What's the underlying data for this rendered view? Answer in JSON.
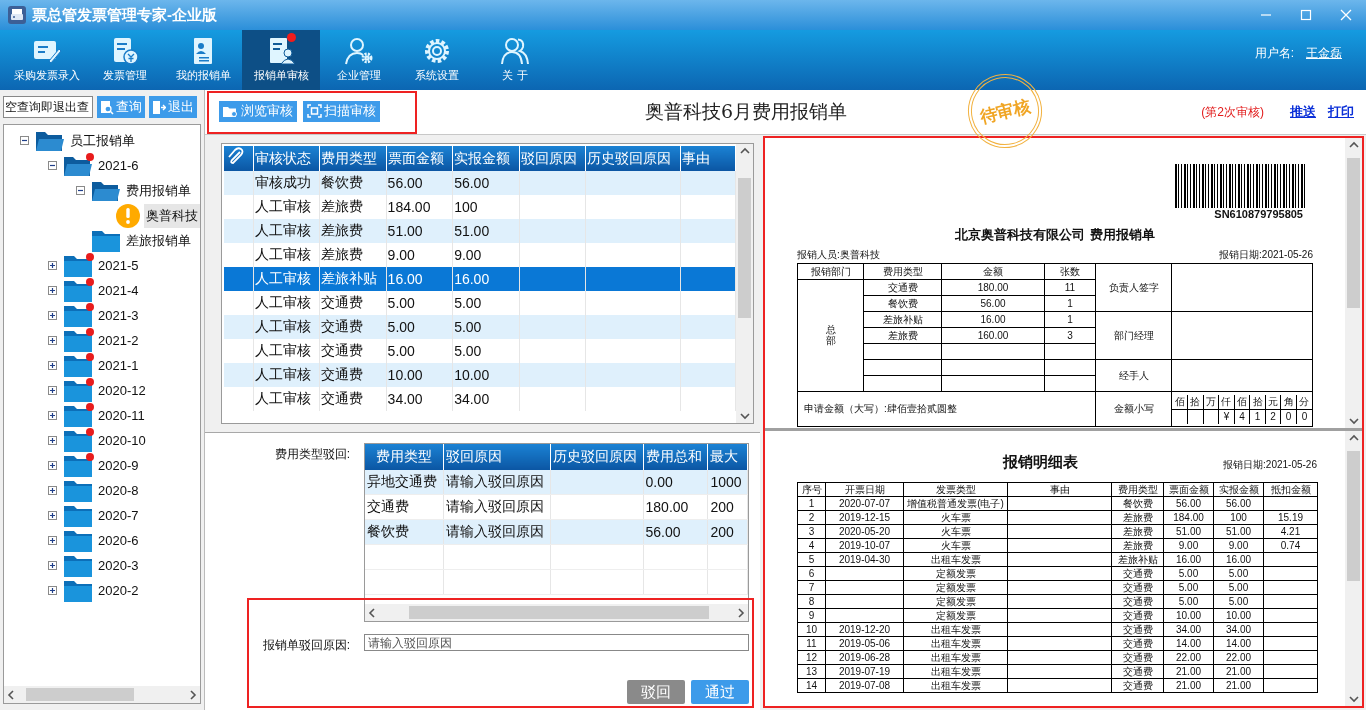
{
  "window": {
    "title": "票总管发票管理专家-企业版"
  },
  "toolbar": {
    "items": [
      {
        "label": "采购发票录入",
        "selected": false,
        "badge": false
      },
      {
        "label": "发票管理",
        "selected": false,
        "badge": false
      },
      {
        "label": "我的报销单",
        "selected": false,
        "badge": false
      },
      {
        "label": "报销单审核",
        "selected": true,
        "badge": true
      },
      {
        "label": "企业管理",
        "selected": false,
        "badge": false
      },
      {
        "label": "系统设置",
        "selected": false,
        "badge": false
      },
      {
        "label": "关 于",
        "selected": false,
        "badge": false
      }
    ],
    "user_label": "用户名:",
    "user_name": "王金磊"
  },
  "sidebar": {
    "search": {
      "value": "空查询即退出查"
    },
    "buttons": [
      {
        "label": "查询",
        "kind": "search"
      },
      {
        "label": "退出",
        "kind": "exit"
      }
    ],
    "tree": [
      {
        "label": "员工报销单",
        "kind": "folder",
        "expanded": true,
        "badge": false,
        "selected": false,
        "children": [
          {
            "label": "2021-6",
            "kind": "folder",
            "expanded": true,
            "badge": true,
            "selected": false,
            "children": [
              {
                "label": "费用报销单",
                "kind": "folder",
                "expanded": true,
                "badge": false,
                "selected": false,
                "children": [
                  {
                    "label": "奥普科技",
                    "kind": "document",
                    "selected": true
                  }
                ]
              },
              {
                "label": "差旅报销单",
                "kind": "folder",
                "badge": false,
                "selected": false
              }
            ]
          },
          {
            "label": "2021-5",
            "kind": "folder",
            "expanded": false,
            "badge": true,
            "selected": false
          },
          {
            "label": "2021-4",
            "kind": "folder",
            "expanded": false,
            "badge": true,
            "selected": false
          },
          {
            "label": "2021-3",
            "kind": "folder",
            "expanded": false,
            "badge": true,
            "selected": false
          },
          {
            "label": "2021-2",
            "kind": "folder",
            "expanded": false,
            "badge": true,
            "selected": false
          },
          {
            "label": "2021-1",
            "kind": "folder",
            "expanded": false,
            "badge": true,
            "selected": false
          },
          {
            "label": "2020-12",
            "kind": "folder",
            "expanded": false,
            "badge": true,
            "selected": false
          },
          {
            "label": "2020-11",
            "kind": "folder",
            "expanded": false,
            "badge": true,
            "selected": false
          },
          {
            "label": "2020-10",
            "kind": "folder",
            "expanded": false,
            "badge": true,
            "selected": false
          },
          {
            "label": "2020-9",
            "kind": "folder",
            "expanded": false,
            "badge": true,
            "selected": false
          },
          {
            "label": "2020-8",
            "kind": "folder",
            "expanded": false,
            "badge": false,
            "selected": false
          },
          {
            "label": "2020-7",
            "kind": "folder",
            "expanded": false,
            "badge": false,
            "selected": false
          },
          {
            "label": "2020-6",
            "kind": "folder",
            "expanded": false,
            "badge": false,
            "selected": false
          },
          {
            "label": "2020-3",
            "kind": "folder",
            "expanded": false,
            "badge": false,
            "selected": false
          },
          {
            "label": "2020-2",
            "kind": "folder",
            "expanded": false,
            "badge": false,
            "selected": false
          }
        ]
      }
    ]
  },
  "header": {
    "buttons": [
      {
        "label": "浏览审核",
        "kind": "browse"
      },
      {
        "label": "扫描审核",
        "kind": "scan"
      }
    ],
    "title": "奥普科技6月费用报销单",
    "stamp": "待审核",
    "round": "(第2次审核)",
    "links": [
      "推送",
      "打印"
    ]
  },
  "review_table": {
    "columns": [
      "审核状态",
      "费用类型",
      "票面金额",
      "实报金额",
      "驳回原因",
      "历史驳回原因",
      "事由"
    ],
    "rows": [
      {
        "status": "审核成功",
        "type": "餐饮费",
        "face": "56.00",
        "actual": "56.00",
        "selected": false
      },
      {
        "status": "人工审核",
        "type": "差旅费",
        "face": "184.00",
        "actual": "100",
        "selected": false
      },
      {
        "status": "人工审核",
        "type": "差旅费",
        "face": "51.00",
        "actual": "51.00",
        "selected": false
      },
      {
        "status": "人工审核",
        "type": "差旅费",
        "face": "9.00",
        "actual": "9.00",
        "selected": false
      },
      {
        "status": "人工审核",
        "type": "差旅补贴",
        "face": "16.00",
        "actual": "16.00",
        "selected": true
      },
      {
        "status": "人工审核",
        "type": "交通费",
        "face": "5.00",
        "actual": "5.00",
        "selected": false
      },
      {
        "status": "人工审核",
        "type": "交通费",
        "face": "5.00",
        "actual": "5.00",
        "selected": false
      },
      {
        "status": "人工审核",
        "type": "交通费",
        "face": "5.00",
        "actual": "5.00",
        "selected": false
      },
      {
        "status": "人工审核",
        "type": "交通费",
        "face": "10.00",
        "actual": "10.00",
        "selected": false
      },
      {
        "status": "人工审核",
        "type": "交通费",
        "face": "34.00",
        "actual": "34.00",
        "selected": false
      }
    ]
  },
  "reject_panel": {
    "type_label": "费用类型驳回:",
    "table": {
      "columns": [
        "费用类型",
        "驳回原因",
        "历史驳回原因",
        "费用总和",
        "最大"
      ],
      "rows": [
        {
          "type": "异地交通费",
          "reason": "请输入驳回原因",
          "total": "0.00",
          "max": "1000"
        },
        {
          "type": "交通费",
          "reason": "请输入驳回原因",
          "total": "180.00",
          "max": "200"
        },
        {
          "type": "餐饮费",
          "reason": "请输入驳回原因",
          "total": "56.00",
          "max": "200"
        }
      ]
    },
    "reason_label": "报销单驳回原因:",
    "reason_placeholder": "请输入驳回原因",
    "buttons": [
      {
        "label": "驳回",
        "kind": "reject"
      },
      {
        "label": "通过",
        "kind": "approve"
      }
    ]
  },
  "expense_form": {
    "serial": "SN610879795805",
    "title": "北京奥普科技有限公司 费用报销单",
    "applicant": "报销人员:奥普科技",
    "date": "报销日期:2021-05-26",
    "columns": [
      "报销部门",
      "费用类型",
      "金额",
      "张数"
    ],
    "department": "总部",
    "items": [
      {
        "type": "交通费",
        "amount": "180.00",
        "count": "11"
      },
      {
        "type": "餐饮费",
        "amount": "56.00",
        "count": "1"
      },
      {
        "type": "差旅补贴",
        "amount": "16.00",
        "count": "1"
      },
      {
        "type": "差旅费",
        "amount": "160.00",
        "count": "3"
      }
    ],
    "signatures": [
      "负责人签字",
      "部门经理",
      "经手人"
    ],
    "amount_words": "申请金额（大写）:肆佰壹拾贰圆整",
    "amount_label": "金额小写",
    "digit_units": [
      "佰",
      "拾",
      "万",
      "仟",
      "佰",
      "拾",
      "元",
      "角",
      "分"
    ],
    "digits": [
      "¥",
      "4",
      "1",
      "2",
      "0",
      "0"
    ]
  },
  "detail_sheet": {
    "title": "报销明细表",
    "date": "报销日期:2021-05-26",
    "columns": [
      "序号",
      "开票日期",
      "发票类型",
      "事由",
      "费用类型",
      "票面金额",
      "实报金额",
      "抵扣金额"
    ],
    "rows": [
      {
        "no": "1",
        "date": "2020-07-07",
        "invoice": "增值税普通发票(电子)",
        "category": "餐饮费",
        "face": "56.00",
        "actual": "56.00"
      },
      {
        "no": "2",
        "date": "2019-12-15",
        "invoice": "火车票",
        "category": "差旅费",
        "face": "184.00",
        "actual": "100",
        "deduction": "15.19"
      },
      {
        "no": "3",
        "date": "2020-05-20",
        "invoice": "火车票",
        "category": "差旅费",
        "face": "51.00",
        "actual": "51.00",
        "deduction": "4.21"
      },
      {
        "no": "4",
        "date": "2019-10-07",
        "invoice": "火车票",
        "category": "差旅费",
        "face": "9.00",
        "actual": "9.00",
        "deduction": "0.74"
      },
      {
        "no": "5",
        "date": "2019-04-30",
        "invoice": "出租车发票",
        "category": "差旅补贴",
        "face": "16.00",
        "actual": "16.00"
      },
      {
        "no": "6",
        "invoice": "定额发票",
        "category": "交通费",
        "face": "5.00",
        "actual": "5.00"
      },
      {
        "no": "7",
        "invoice": "定额发票",
        "category": "交通费",
        "face": "5.00",
        "actual": "5.00"
      },
      {
        "no": "8",
        "invoice": "定额发票",
        "category": "交通费",
        "face": "5.00",
        "actual": "5.00"
      },
      {
        "no": "9",
        "invoice": "定额发票",
        "category": "交通费",
        "face": "10.00",
        "actual": "10.00"
      },
      {
        "no": "10",
        "date": "2019-12-20",
        "invoice": "出租车发票",
        "category": "交通费",
        "face": "34.00",
        "actual": "34.00"
      },
      {
        "no": "11",
        "date": "2019-05-06",
        "invoice": "出租车发票",
        "category": "交通费",
        "face": "14.00",
        "actual": "14.00"
      },
      {
        "no": "12",
        "date": "2019-06-28",
        "invoice": "出租车发票",
        "category": "交通费",
        "face": "22.00",
        "actual": "22.00"
      },
      {
        "no": "13",
        "date": "2019-07-19",
        "invoice": "出租车发票",
        "category": "交通费",
        "face": "21.00",
        "actual": "21.00"
      },
      {
        "no": "14",
        "date": "2019-07-08",
        "invoice": "出租车发票",
        "category": "交通费",
        "face": "21.00",
        "actual": "21.00"
      }
    ]
  }
}
